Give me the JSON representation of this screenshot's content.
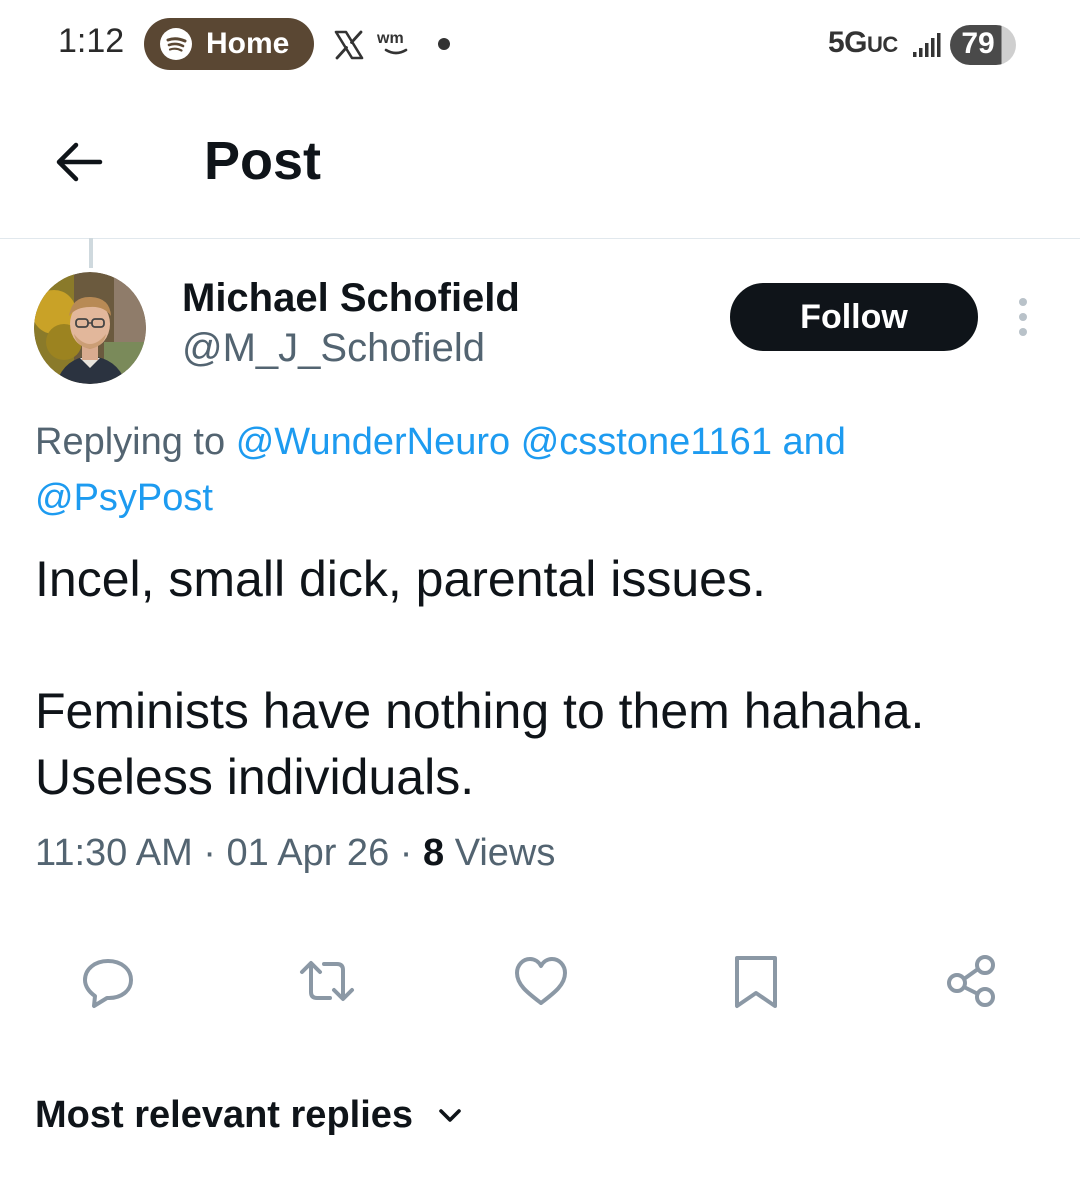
{
  "status_bar": {
    "time": "1:12",
    "media_pill_label": "Home",
    "media_icon": "spotify-icon",
    "notification_icons": [
      "x-icon",
      "wm-icon",
      "dot-icon"
    ],
    "network": "5G",
    "network_suffix": "UC",
    "battery": "79",
    "battery_level": 0.79
  },
  "header": {
    "title": "Post",
    "back_icon": "arrow-left-icon"
  },
  "post": {
    "author": {
      "display_name": "Michael Schofield",
      "handle": "@M_J_Schofield"
    },
    "follow_label": "Follow",
    "replying_prefix": "Replying to",
    "mentions": [
      "@WunderNeuro",
      "@csstone1161"
    ],
    "mention_joiner": "and",
    "last_mention": "@PsyPost",
    "text_paragraph_1": "Incel, small dick, parental issues.",
    "text_paragraph_2_line_1": "Feminists have nothing to them hahaha.",
    "text_paragraph_2_line_2": "Useless individuals.",
    "time": "11:30 AM",
    "separator": "·",
    "date": "01 Apr 26",
    "views_count": "8",
    "views_label": "Views"
  },
  "actions": [
    "reply-icon",
    "repost-icon",
    "like-icon",
    "bookmark-icon",
    "share-icon"
  ],
  "replies_sort": {
    "label": "Most relevant replies"
  },
  "colors": {
    "text": "#0f1419",
    "secondary_text": "#536471",
    "link": "#1d9bf0",
    "icon": "#8b98a5",
    "divider": "#e1e8ed",
    "pill_bg": "#5a4733"
  }
}
